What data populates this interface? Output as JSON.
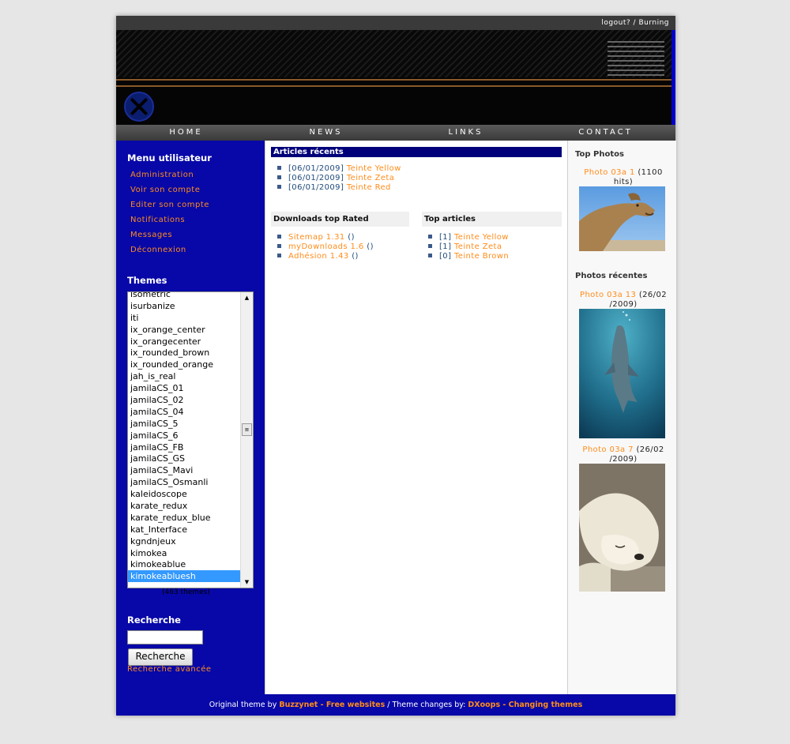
{
  "topbar": {
    "logout": "logout?",
    "separator": "/",
    "user": "Burning"
  },
  "nav": [
    "HOME",
    "NEWS",
    "LINKS",
    "CONTACT"
  ],
  "user_menu": {
    "title": "Menu utilisateur",
    "items": [
      "Administration",
      "Voir son compte",
      "Editer son compte",
      "Notifications",
      "Messages",
      "Déconnexion"
    ]
  },
  "themes": {
    "title": "Themes",
    "options": [
      "isometric",
      "isurbanize",
      "iti",
      "ix_orange_center",
      "ix_orangecenter",
      "ix_rounded_brown",
      "ix_rounded_orange",
      "jah_is_real",
      "jamilaCS_01",
      "jamilaCS_02",
      "jamilaCS_04",
      "jamilaCS_5",
      "jamilaCS_6",
      "jamilaCS_FB",
      "jamilaCS_GS",
      "jamilaCS_Mavi",
      "jamilaCS_Osmanli",
      "kaleidoscope",
      "karate_redux",
      "karate_redux_blue",
      "kat_Interface",
      "kgndnjeux",
      "kimokea",
      "kimokeablue",
      "kimokeabluesh"
    ],
    "selected": "kimokeabluesh",
    "count": "(463 themes)"
  },
  "search": {
    "title": "Recherche",
    "value": "",
    "button": "Recherche",
    "advanced": "Recherche avancée"
  },
  "recent_articles": {
    "title": "Articles récents",
    "items": [
      {
        "date": "[06/01/2009]",
        "title": "Teinte Yellow"
      },
      {
        "date": "[06/01/2009]",
        "title": "Teinte Zeta"
      },
      {
        "date": "[06/01/2009]",
        "title": "Teinte Red"
      }
    ]
  },
  "downloads_top": {
    "title": "Downloads top Rated",
    "items": [
      {
        "name": "Sitemap 1.31",
        "count": "()"
      },
      {
        "name": "myDownloads 1.6",
        "count": "()"
      },
      {
        "name": "Adhésion 1.43",
        "count": "()"
      }
    ]
  },
  "top_articles": {
    "title": "Top articles",
    "items": [
      {
        "count": "[1]",
        "title": "Teinte Yellow"
      },
      {
        "count": "[1]",
        "title": "Teinte Zeta"
      },
      {
        "count": "[0]",
        "title": "Teinte Brown"
      }
    ]
  },
  "top_photos": {
    "title": "Top Photos",
    "items": [
      {
        "name": "Photo 03a 1",
        "meta1": " (1100",
        "meta2": "hits)"
      }
    ]
  },
  "recent_photos": {
    "title": "Photos récentes",
    "items": [
      {
        "name": "Photo 03a 13",
        "meta1": " (26/02",
        "meta2": "/2009)"
      },
      {
        "name": "Photo 03a 7",
        "meta1": " (26/02",
        "meta2": "/2009)"
      }
    ]
  },
  "footer": {
    "prefix": "Original theme by ",
    "link1": "Buzzynet - Free websites",
    "middle": " / Theme changes by: ",
    "link2": "DXoops - Changing themes"
  },
  "colors": {
    "accent": "#ff8c1a",
    "sidebar": "#0808a8",
    "header_bar": "#00007a",
    "selected": "#3399ff"
  }
}
